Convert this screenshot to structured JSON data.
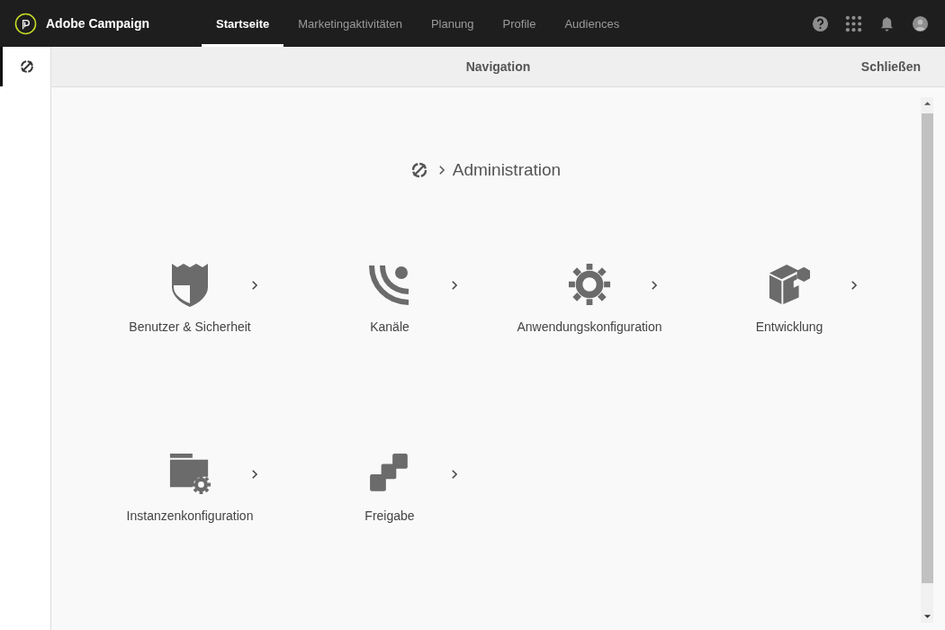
{
  "app": {
    "title": "Adobe Campaign"
  },
  "tabs": [
    {
      "label": "Startseite",
      "selected": true
    },
    {
      "label": "Marketingaktivitäten",
      "selected": false
    },
    {
      "label": "Planung",
      "selected": false
    },
    {
      "label": "Profile",
      "selected": false
    },
    {
      "label": "Audiences",
      "selected": false
    }
  ],
  "panel": {
    "title": "Navigation",
    "close": "Schließen",
    "breadcrumb": "Administration"
  },
  "tiles": [
    {
      "label": "Benutzer & Sicherheit"
    },
    {
      "label": "Kanäle"
    },
    {
      "label": "Anwendungskonfiguration"
    },
    {
      "label": "Entwicklung"
    },
    {
      "label": "Instanzenkonfiguration"
    },
    {
      "label": "Freigabe"
    }
  ]
}
